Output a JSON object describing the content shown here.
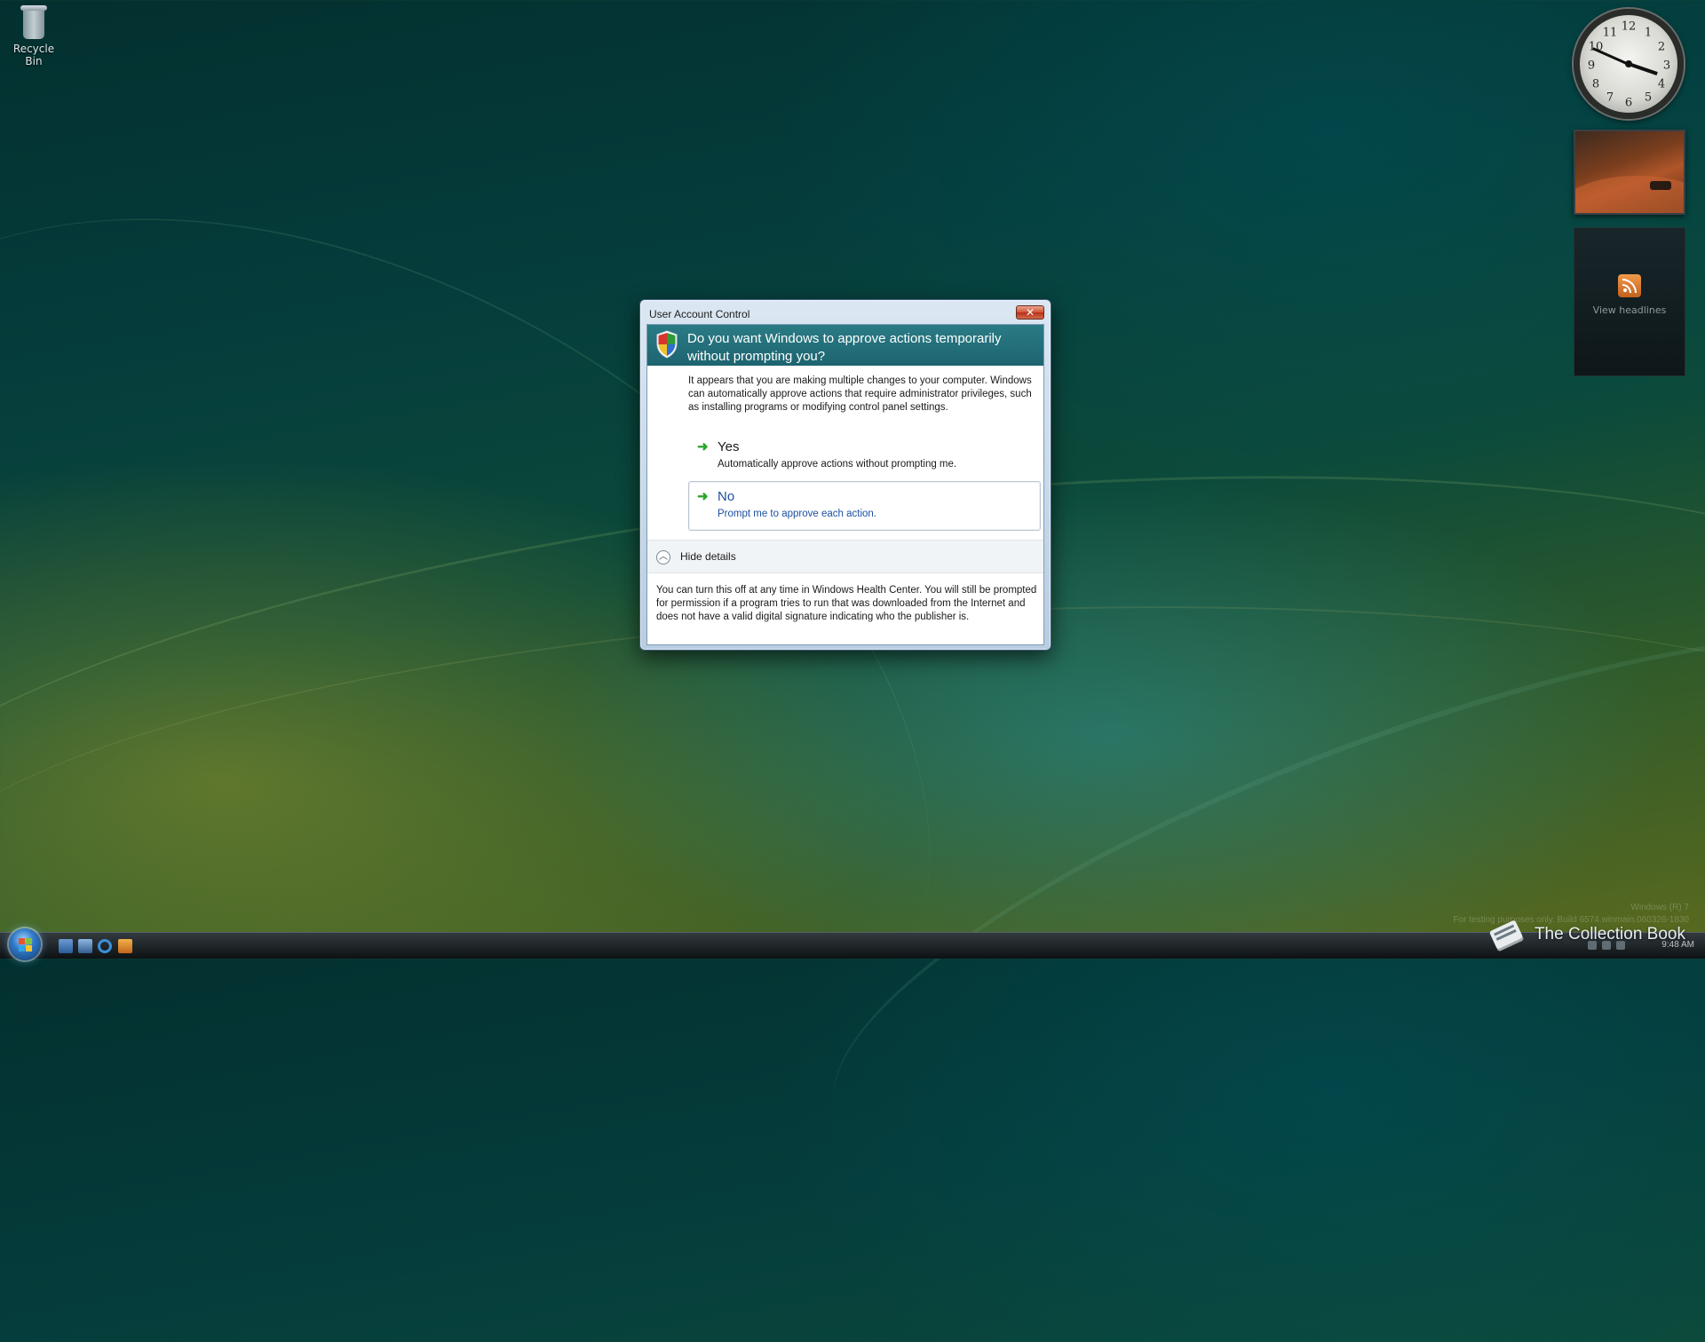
{
  "desktop": {
    "recycle_bin_label": "Recycle Bin"
  },
  "gadgets": {
    "clock_numbers": [
      "12",
      "1",
      "2",
      "3",
      "4",
      "5",
      "6",
      "7",
      "8",
      "9",
      "10",
      "11"
    ],
    "feed_label": "View headlines"
  },
  "dialog": {
    "window_title": "User Account Control",
    "close_glyph": "✕",
    "heading": "Do you want Windows to approve actions temporarily without prompting you?",
    "intro": "It appears that you are making multiple changes to your computer. Windows can automatically approve actions that require administrator privileges, such as installing programs or modifying control panel settings.",
    "options": [
      {
        "label": "Yes",
        "description": "Automatically approve actions without prompting me."
      },
      {
        "label": "No",
        "description": "Prompt me to approve each action."
      }
    ],
    "details_toggle": "Hide details",
    "details_text": "You can turn this off at any time in Windows Health Center.  You will still be prompted for permission if a program tries to run that was downloaded from the Internet and does not have a valid digital signature indicating who the publisher is.",
    "accent_color": "#1d6470"
  },
  "taskbar": {
    "time": "9:48 AM"
  },
  "watermark": {
    "line1": "Windows (R) 7",
    "line2": "For testing purposes only. Build 6574.winmain.060326-1830"
  },
  "brand": {
    "name": "The Collection Book"
  }
}
